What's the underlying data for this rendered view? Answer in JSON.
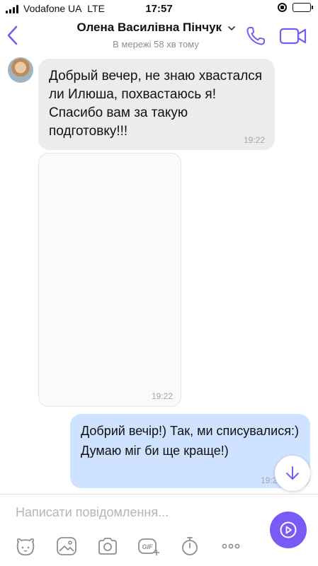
{
  "status_bar": {
    "carrier": "Vodafone UA",
    "network": "LTE",
    "time": "17:57",
    "battery_level": 0.85
  },
  "header": {
    "contact_name": "Олена Василівна Пінчук",
    "last_seen": "В мережі 58 хв тому",
    "accent_color": "#7a5af5"
  },
  "messages": [
    {
      "direction": "incoming",
      "text": "Добрый вечер, не знаю хвастался ли Илюша, похвастаюсь я! Спасибо вам за такую подготовку!!!",
      "time": "19:22"
    },
    {
      "direction": "incoming",
      "type": "image",
      "time": "19:22"
    },
    {
      "direction": "outgoing",
      "text": "Добрий вечір!) Так, ми списувалися:) Думаю міг би ще краще!)",
      "time": "19:22"
    }
  ],
  "composer": {
    "placeholder": "Написати повідомлення...",
    "value": ""
  },
  "toolbar": {
    "gif_label": "GIF",
    "icons": [
      "sticker-icon",
      "gallery-icon",
      "camera-icon",
      "gif-icon",
      "timer-icon",
      "more-icon"
    ]
  },
  "colors": {
    "incoming_bubble": "#ececee",
    "outgoing_bubble": "#cfe2ff",
    "accent": "#7a5af5"
  }
}
